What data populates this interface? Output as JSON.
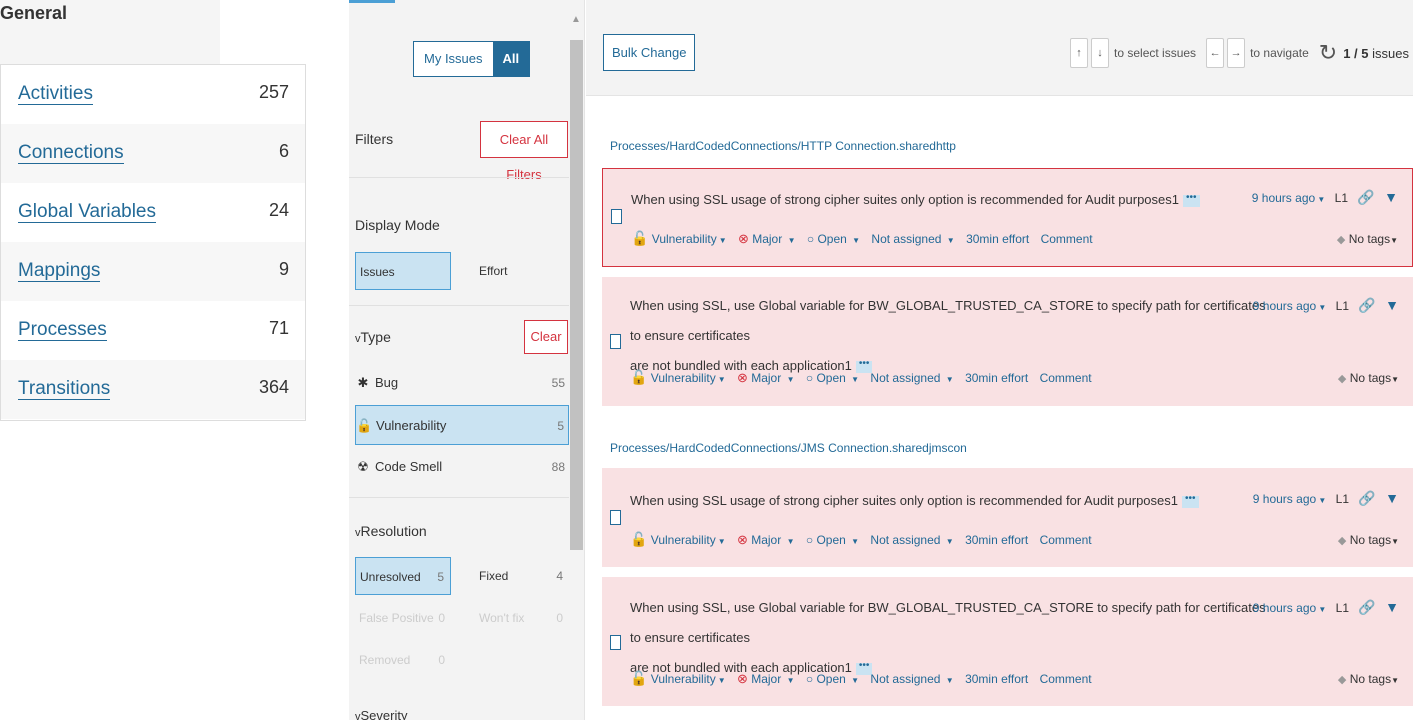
{
  "general": {
    "title": "General",
    "stats": [
      {
        "label": "Activities",
        "count": "257"
      },
      {
        "label": "Connections",
        "count": "6"
      },
      {
        "label": "Global Variables",
        "count": "24"
      },
      {
        "label": "Mappings",
        "count": "9"
      },
      {
        "label": "Processes",
        "count": "71"
      },
      {
        "label": "Transitions",
        "count": "364"
      }
    ]
  },
  "filters": {
    "my_issues": "My Issues",
    "all": "All",
    "filters_label": "Filters",
    "clear_all": "Clear All Filters",
    "display_mode": {
      "title": "Display Mode",
      "issues": "Issues",
      "effort": "Effort"
    },
    "type": {
      "title": "Type",
      "clear": "Clear",
      "items": [
        {
          "label": "Bug",
          "count": "55",
          "icon": "bug-icon"
        },
        {
          "label": "Vulnerability",
          "count": "5",
          "icon": "lock-open-icon"
        },
        {
          "label": "Code Smell",
          "count": "88",
          "icon": "code-smell-icon"
        }
      ]
    },
    "resolution": {
      "title": "Resolution",
      "unresolved": {
        "label": "Unresolved",
        "count": "5"
      },
      "fixed": {
        "label": "Fixed",
        "count": "4"
      },
      "false_positive": {
        "label": "False Positive",
        "count": "0"
      },
      "wont_fix": {
        "label": "Won't fix",
        "count": "0"
      },
      "removed": {
        "label": "Removed",
        "count": "0"
      }
    },
    "next_section": "Severity"
  },
  "toolbar": {
    "bulk_change": "Bulk Change",
    "up_key": "↑",
    "down_key": "↓",
    "select_text": "to select issues",
    "left_key": "←",
    "right_key": "→",
    "navigate_text": "to navigate",
    "issues_current": "1 / 5",
    "issues_suffix": "issues"
  },
  "components": [
    "Processes/HardCodedConnections/HTTP Connection.sharedhttp",
    "Processes/HardCodedConnections/JMS Connection.sharedjmscon"
  ],
  "issue_common": {
    "type": "Vulnerability",
    "severity": "Major",
    "status": "Open",
    "assignee": "Not assigned",
    "effort": "30min effort",
    "comment": "Comment",
    "age": "9 hours ago",
    "line": "L1",
    "tags": "No tags",
    "dots": "•••"
  },
  "issues": [
    {
      "message": "When using SSL usage of strong cipher suites only option is recommended for Audit purposes1"
    },
    {
      "message_line1": "When using SSL, use Global variable for BW_GLOBAL_TRUSTED_CA_STORE to specify path for certificates to ensure certificates",
      "message_line2": "are not bundled with each application1"
    },
    {
      "message": "When using SSL usage of strong cipher suites only option is recommended for Audit purposes1"
    },
    {
      "message_line1": "When using SSL, use Global variable for BW_GLOBAL_TRUSTED_CA_STORE to specify path for certificates to ensure certificates",
      "message_line2": "are not bundled with each application1"
    }
  ],
  "colors": {
    "accent": "#236a97",
    "danger": "#d4333f",
    "issue_bg": "#f9e1e3",
    "selected_bg": "#cae3f2"
  }
}
